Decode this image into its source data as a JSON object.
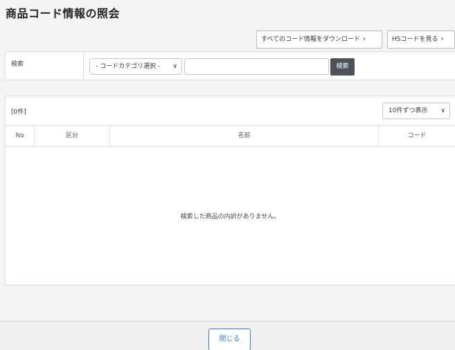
{
  "page": {
    "title": "商品コード情報の照会"
  },
  "toolbar": {
    "download_all_label": "すべてのコード情報をダウンロード",
    "hs_code_label": "HSコードを見る"
  },
  "search": {
    "label": "検索",
    "category_selected": "- コードカテゴリ選択 -",
    "query_value": "",
    "query_placeholder": "",
    "button_label": "検索"
  },
  "results": {
    "count_label": "[0件]",
    "per_page_selected": "10件ずつ表示",
    "columns": [
      "No",
      "区分",
      "名前",
      "コード"
    ],
    "rows": [],
    "empty_message": "検索した商品の内訳がありません。"
  },
  "footer": {
    "close_label": "閉じる"
  },
  "icons": {
    "chevron_right": "chevron-right-icon",
    "dropdown": "chevron-down-icon"
  },
  "colors": {
    "search_button_bg": "#4a525a",
    "close_button_accent": "#3a78c2"
  }
}
